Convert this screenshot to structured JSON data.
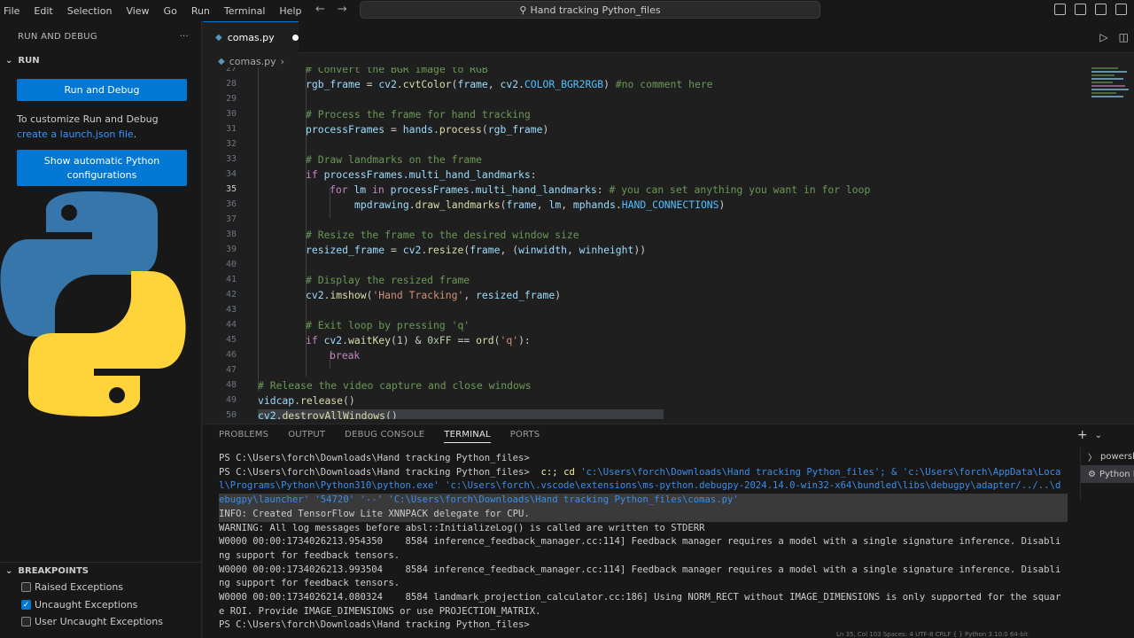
{
  "titlebar": {
    "menu": [
      "File",
      "Edit",
      "Selection",
      "View",
      "Go",
      "Run",
      "Terminal",
      "Help"
    ],
    "search_text": "Hand tracking Python_files"
  },
  "sidebar": {
    "title": "RUN AND DEBUG",
    "section": "RUN",
    "run_button": "Run and Debug",
    "customize_text": "To customize Run and Debug ",
    "customize_link": "create a launch.json file",
    "customize_end": ".",
    "show_button": "Show automatic Python configurations",
    "breakpoints_title": "BREAKPOINTS",
    "breakpoints": [
      {
        "label": "Raised Exceptions",
        "checked": false
      },
      {
        "label": "Uncaught Exceptions",
        "checked": true
      },
      {
        "label": "User Uncaught Exceptions",
        "checked": false
      }
    ]
  },
  "editor": {
    "tab_label": "comas.py",
    "breadcrumb": "comas.py",
    "current_line": 35,
    "lines": [
      {
        "n": 27,
        "text": "# Convert the BGR image to RGB"
      },
      {
        "n": 28,
        "text": "rgb_frame = cv2.cvtColor(frame, cv2.COLOR_BGR2RGB) #no comment here"
      },
      {
        "n": 29,
        "text": ""
      },
      {
        "n": 30,
        "text": "# Process the frame for hand tracking"
      },
      {
        "n": 31,
        "text": "processFrames = hands.process(rgb_frame)"
      },
      {
        "n": 32,
        "text": ""
      },
      {
        "n": 33,
        "text": "# Draw landmarks on the frame"
      },
      {
        "n": 34,
        "text": "if processFrames.multi_hand_landmarks:"
      },
      {
        "n": 35,
        "text": "for lm in processFrames.multi_hand_landmarks: # you can set anything you want in for loop"
      },
      {
        "n": 36,
        "text": "mpdrawing.draw_landmarks(frame, lm, mphands.HAND_CONNECTIONS)"
      },
      {
        "n": 37,
        "text": ""
      },
      {
        "n": 38,
        "text": "# Resize the frame to the desired window size"
      },
      {
        "n": 39,
        "text": "resized_frame = cv2.resize(frame, (winwidth, winheight))"
      },
      {
        "n": 40,
        "text": ""
      },
      {
        "n": 41,
        "text": "# Display the resized frame"
      },
      {
        "n": 42,
        "text": "cv2.imshow('Hand Tracking', resized_frame)"
      },
      {
        "n": 43,
        "text": ""
      },
      {
        "n": 44,
        "text": "# Exit loop by pressing 'q'"
      },
      {
        "n": 45,
        "text": "if cv2.waitKey(1) & 0xFF == ord('q'):"
      },
      {
        "n": 46,
        "text": "break"
      },
      {
        "n": 47,
        "text": ""
      },
      {
        "n": 48,
        "text": "# Release the video capture and close windows"
      },
      {
        "n": 49,
        "text": "vidcap.release()"
      },
      {
        "n": 50,
        "text": "cv2.destroyAllWindows()"
      }
    ]
  },
  "panel": {
    "tabs": [
      "PROBLEMS",
      "OUTPUT",
      "DEBUG CONSOLE",
      "TERMINAL",
      "PORTS"
    ],
    "active_tab": "TERMINAL",
    "terminal_lines": [
      "PS C:\\Users\\forch\\Downloads\\Hand tracking Python_files>",
      "PS C:\\Users\\forch\\Downloads\\Hand tracking Python_files>  c:; cd 'c:\\Users\\forch\\Downloads\\Hand tracking Python_files'; & 'c:\\Users\\forch\\AppData\\Loca",
      "l\\Programs\\Python\\Python310\\python.exe' 'c:\\Users\\forch\\.vscode\\extensions\\ms-python.debugpy-2024.14.0-win32-x64\\bundled\\libs\\debugpy\\adapter/../..\\d",
      "ebugpy\\launcher' '54720' '--' 'C:\\Users\\forch\\Downloads\\Hand tracking Python_files\\comas.py'",
      "INFO: Created TensorFlow Lite XNNPACK delegate for CPU.",
      "WARNING: All log messages before absl::InitializeLog() is called are written to STDERR",
      "W0000 00:00:1734026213.954350    8584 inference_feedback_manager.cc:114] Feedback manager requires a model with a single signature inference. Disabli",
      "ng support for feedback tensors.",
      "W0000 00:00:1734026213.993504    8584 inference_feedback_manager.cc:114] Feedback manager requires a model with a single signature inference. Disabli",
      "ng support for feedback tensors.",
      "W0000 00:00:1734026214.080324    8584 landmark_projection_calculator.cc:186] Using NORM_RECT without IMAGE_DIMENSIONS is only supported for the squar",
      "e ROI. Provide IMAGE_DIMENSIONS or use PROJECTION_MATRIX.",
      "PS C:\\Users\\forch\\Downloads\\Hand tracking Python_files> "
    ],
    "terminal_list": [
      "powershell",
      "Python Debug"
    ]
  },
  "statusbar": {
    "text": "Ln 35, Col 103   Spaces: 4   UTF-8   CRLF   { } Python   3.10.0 64-bit"
  },
  "colors": {
    "accent": "#0078d4",
    "python_blue": "#3776ab",
    "python_yellow": "#ffd43b"
  }
}
